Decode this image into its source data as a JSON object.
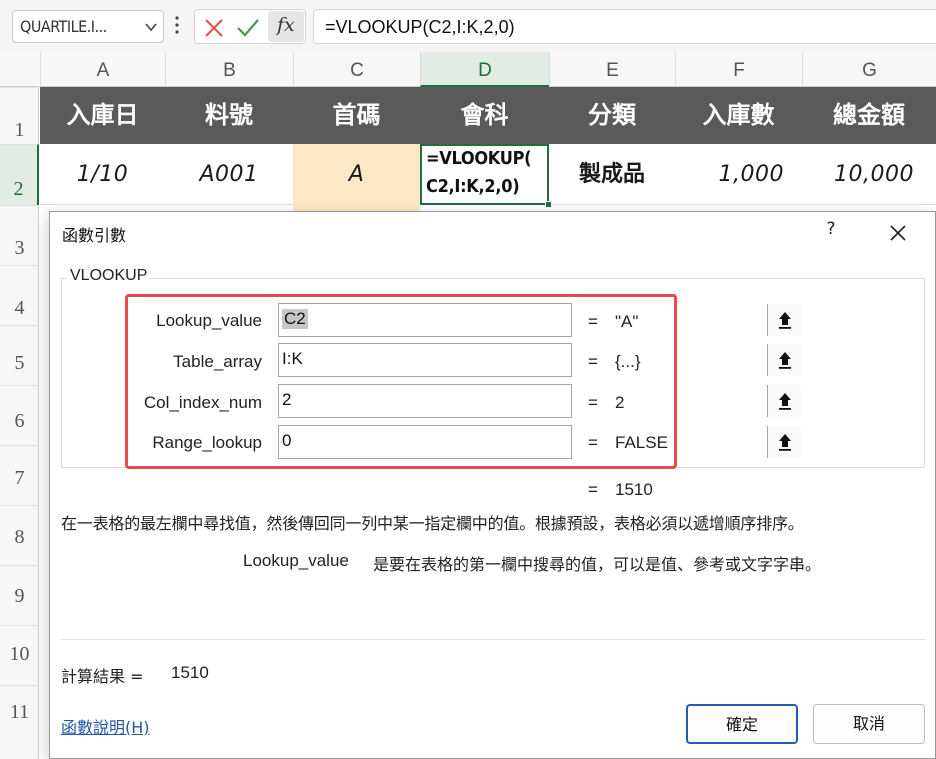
{
  "formula_bar": {
    "name_box": "QUARTILE.I...",
    "formula": "=VLOOKUP(C2,I:K,2,0)",
    "fx_label": "fx",
    "icons": [
      "chevron-down-icon",
      "more-vertical-icon",
      "close-icon",
      "check-icon",
      "fx-icon"
    ]
  },
  "sheet": {
    "columns": [
      "A",
      "B",
      "C",
      "D",
      "E",
      "F",
      "G"
    ],
    "selected_column": "D",
    "rows": [
      "1",
      "2",
      "3",
      "4",
      "5",
      "6",
      "7",
      "8",
      "9",
      "10",
      "11"
    ],
    "selected_row": "2",
    "header_row": [
      "入庫日",
      "料號",
      "首碼",
      "會科",
      "分類",
      "入庫數",
      "總金額"
    ],
    "data_row": {
      "a": "1/10",
      "b": "A001",
      "c": "A",
      "d_line1": "=VLOOKUP(",
      "d_line2": "C2,I:K,2,0)",
      "e": "製成品",
      "f": "1,000",
      "g": "10,000"
    },
    "colors": {
      "header_bg": "#5a5a5a",
      "highlight": "#fce8c4",
      "select": "#1d6f42"
    }
  },
  "dialog": {
    "title": "函數引數",
    "help": "?",
    "function_name": "VLOOKUP",
    "args": [
      {
        "label": "Lookup_value",
        "value": "C2",
        "equals": "=",
        "result": "\"A\""
      },
      {
        "label": "Table_array",
        "value": "I:K",
        "equals": "=",
        "result": "{...}"
      },
      {
        "label": "Col_index_num",
        "value": "2",
        "equals": "=",
        "result": "2"
      },
      {
        "label": "Range_lookup",
        "value": "0",
        "equals": "=",
        "result": "FALSE"
      }
    ],
    "function_result_eq": "=",
    "function_result": "1510",
    "description": "在一表格的最左欄中尋找值，然後傳回同一列中某一指定欄中的值。根據預設，表格必須以遞增順序排序。",
    "arg_name": "Lookup_value",
    "arg_help": "是要在表格的第一欄中搜尋的值，可以是值、參考或文字字串。",
    "calc_label": "計算結果 =",
    "calc_value": "1510",
    "help_link": "函數說明(H)",
    "ok": "確定",
    "cancel": "取消",
    "highlight_color": "#e64b4b"
  }
}
